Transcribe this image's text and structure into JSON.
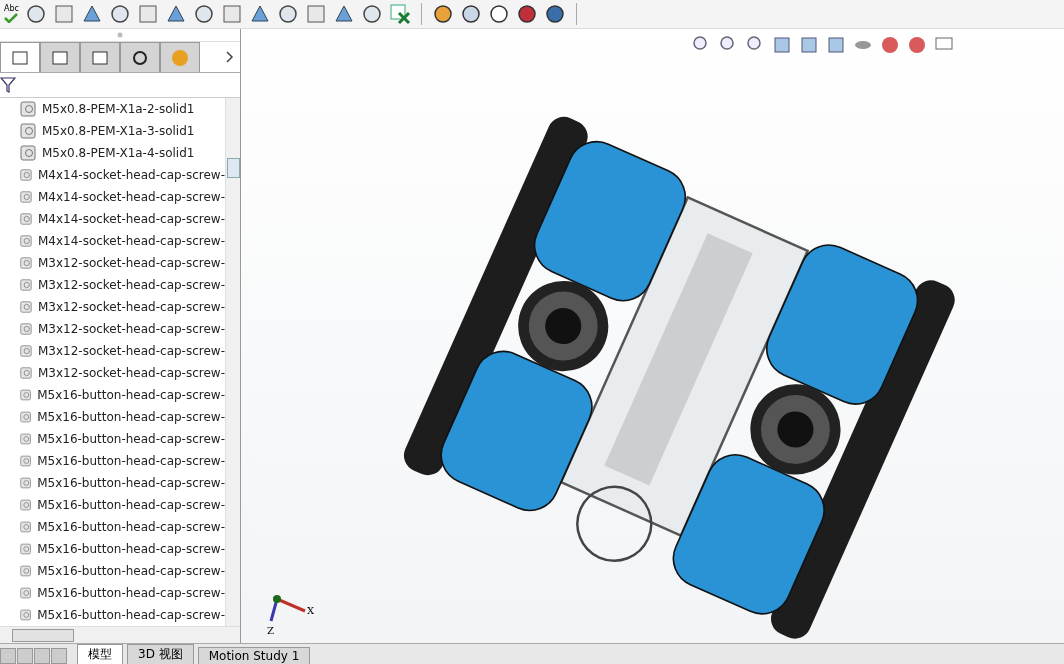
{
  "toolbar": {
    "spell_label": "Abc"
  },
  "manager_tabs": [
    {
      "selected": true
    },
    {
      "selected": false
    },
    {
      "selected": false
    },
    {
      "selected": false
    },
    {
      "selected": false
    }
  ],
  "tree": {
    "items": [
      {
        "label": "M5x0.8-PEM-X1a-2-solid1"
      },
      {
        "label": "M5x0.8-PEM-X1a-3-solid1"
      },
      {
        "label": "M5x0.8-PEM-X1a-4-solid1"
      },
      {
        "label": "M4x14-socket-head-cap-screw-"
      },
      {
        "label": "M4x14-socket-head-cap-screw-"
      },
      {
        "label": "M4x14-socket-head-cap-screw-"
      },
      {
        "label": "M4x14-socket-head-cap-screw-"
      },
      {
        "label": "M3x12-socket-head-cap-screw-"
      },
      {
        "label": "M3x12-socket-head-cap-screw-"
      },
      {
        "label": "M3x12-socket-head-cap-screw-"
      },
      {
        "label": "M3x12-socket-head-cap-screw-"
      },
      {
        "label": "M3x12-socket-head-cap-screw-"
      },
      {
        "label": "M3x12-socket-head-cap-screw-"
      },
      {
        "label": "M5x16-button-head-cap-screw-"
      },
      {
        "label": "M5x16-button-head-cap-screw-"
      },
      {
        "label": "M5x16-button-head-cap-screw-"
      },
      {
        "label": "M5x16-button-head-cap-screw-"
      },
      {
        "label": "M5x16-button-head-cap-screw-"
      },
      {
        "label": "M5x16-button-head-cap-screw-"
      },
      {
        "label": "M5x16-button-head-cap-screw-"
      },
      {
        "label": "M5x16-button-head-cap-screw-"
      },
      {
        "label": "M5x16-button-head-cap-screw-"
      },
      {
        "label": "M5x16-button-head-cap-screw-"
      },
      {
        "label": "M5x16-button-head-cap-screw-"
      }
    ]
  },
  "bottom_tabs": [
    {
      "label": "模型",
      "selected": true
    },
    {
      "label": "3D 视图",
      "selected": false
    },
    {
      "label": "Motion Study 1",
      "selected": false
    }
  ],
  "triad": {
    "x_label": "X",
    "z_label": "Z"
  }
}
